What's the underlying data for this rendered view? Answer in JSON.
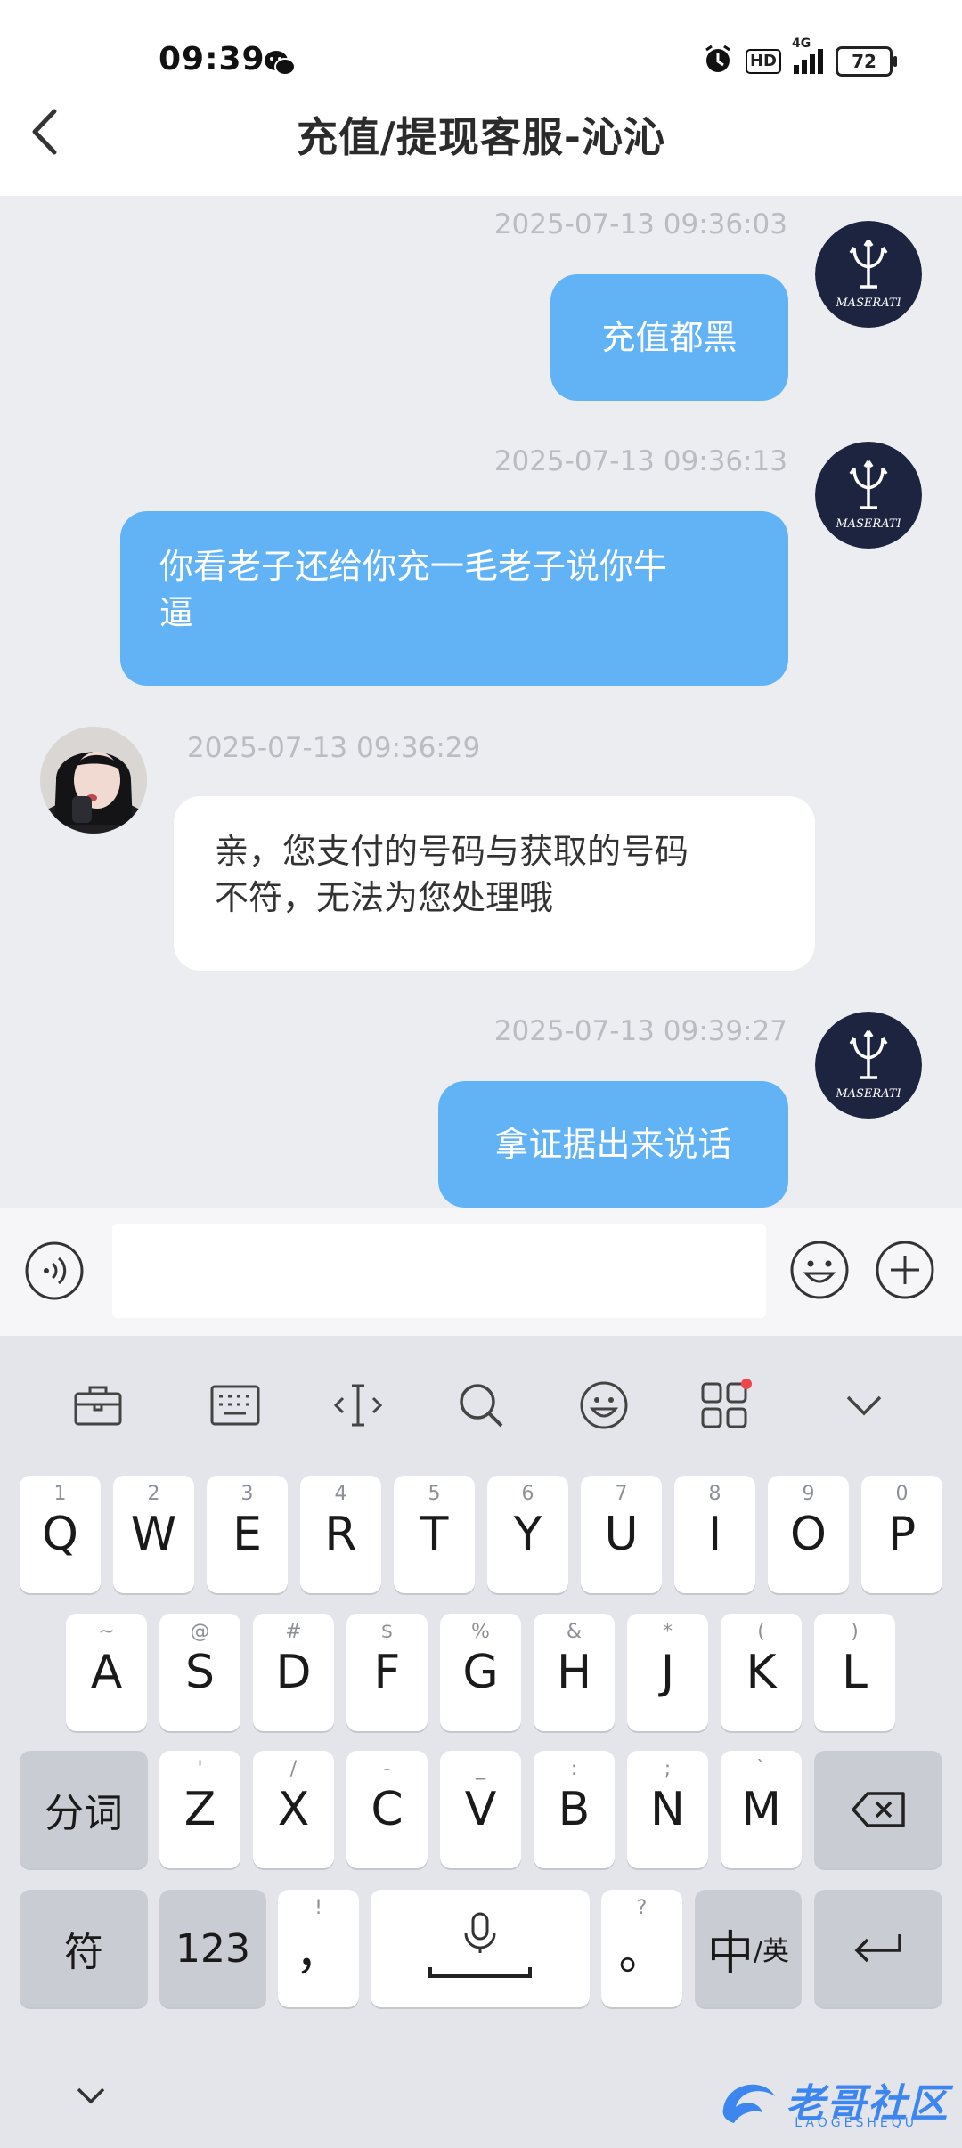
{
  "status_bar": {
    "time": "09:39",
    "battery": "72",
    "network": "4G",
    "hd": "HD"
  },
  "header": {
    "title": "充值/提现客服-沁沁"
  },
  "messages": [
    {
      "side": "out",
      "time": "2025-07-13 09:36:03",
      "text": "充值都黑",
      "avatar": "maserati-logo"
    },
    {
      "side": "out",
      "time": "2025-07-13 09:36:13",
      "text_line1": "你看老子还给你充一毛老子说你牛",
      "text_line2": "逼",
      "avatar": "maserati-logo"
    },
    {
      "side": "in",
      "time": "2025-07-13 09:36:29",
      "text_line1": "亲，您支付的号码与获取的号码",
      "text_line2": "不符，无法为您处理哦",
      "avatar": "agent-photo"
    },
    {
      "side": "out",
      "time": "2025-07-13 09:39:27",
      "text": "拿证据出来说话",
      "avatar": "maserati-logo"
    }
  ],
  "avatar_logo_text": "MASERATI",
  "input": {
    "value": "",
    "placeholder": ""
  },
  "keyboard": {
    "row1": [
      {
        "k": "Q",
        "h": "1"
      },
      {
        "k": "W",
        "h": "2"
      },
      {
        "k": "E",
        "h": "3"
      },
      {
        "k": "R",
        "h": "4"
      },
      {
        "k": "T",
        "h": "5"
      },
      {
        "k": "Y",
        "h": "6"
      },
      {
        "k": "U",
        "h": "7"
      },
      {
        "k": "I",
        "h": "8"
      },
      {
        "k": "O",
        "h": "9"
      },
      {
        "k": "P",
        "h": "0"
      }
    ],
    "row2": [
      {
        "k": "A",
        "h": "~"
      },
      {
        "k": "S",
        "h": "@"
      },
      {
        "k": "D",
        "h": "#"
      },
      {
        "k": "F",
        "h": "$"
      },
      {
        "k": "G",
        "h": "%"
      },
      {
        "k": "H",
        "h": "&"
      },
      {
        "k": "J",
        "h": "*"
      },
      {
        "k": "K",
        "h": "("
      },
      {
        "k": "L",
        "h": ")"
      }
    ],
    "row3": [
      {
        "k": "Z",
        "h": "'"
      },
      {
        "k": "X",
        "h": "/"
      },
      {
        "k": "C",
        "h": "-"
      },
      {
        "k": "V",
        "h": "_"
      },
      {
        "k": "B",
        "h": ":"
      },
      {
        "k": "N",
        "h": ";"
      },
      {
        "k": "M",
        "h": "`"
      }
    ],
    "fenci": "分词",
    "fu": "符",
    "num": "123",
    "comma": "，",
    "comma_hint": "!",
    "period": "。",
    "period_hint": "?",
    "zh": "中",
    "en": "/英"
  },
  "watermark": {
    "text": "老哥社区",
    "sub": "LAOGESHEQU"
  }
}
